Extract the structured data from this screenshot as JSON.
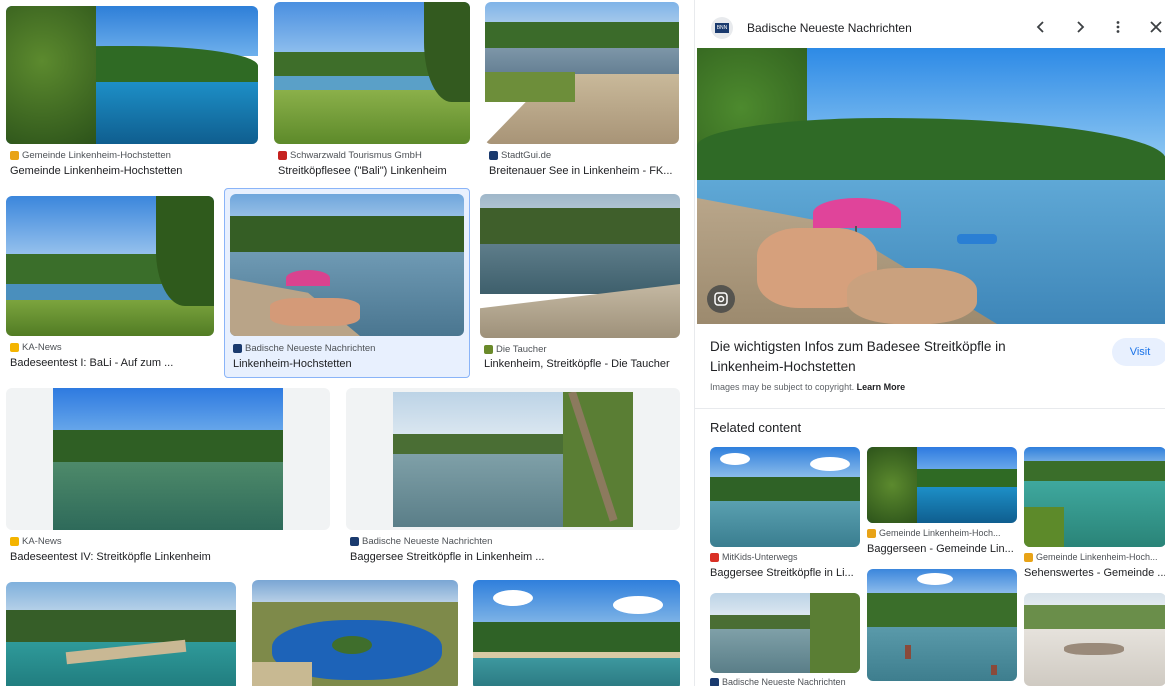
{
  "grid": [
    {
      "source": "Gemeinde Linkenheim-Hochstetten",
      "title": "Gemeinde Linkenheim-Hochstetten",
      "favicon": "crest-icon",
      "favicon_color": "#e8a317"
    },
    {
      "source": "Schwarzwald Tourismus GmbH",
      "title": "Streitköpflesee (\"Bali\") Linkenheim",
      "favicon": "flag-icon",
      "favicon_color": "#c5221f"
    },
    {
      "source": "StadtGui.de",
      "title": "Breitenauer See in Linkenheim - FK...",
      "favicon": "s-icon",
      "favicon_color": "#1a3a6e"
    },
    {
      "source": "KA-News",
      "title": "Badeseentest I: BaLi - Auf zum ...",
      "favicon": "ka-icon",
      "favicon_color": "#f4b400"
    },
    {
      "source": "Badische Neueste Nachrichten",
      "title": "Linkenheim-Hochstetten",
      "favicon": "bnn-icon",
      "favicon_color": "#1a3a6e"
    },
    {
      "source": "Die Taucher",
      "title": "Linkenheim, Streitköpfle - Die Taucher",
      "favicon": "diver-icon",
      "favicon_color": "#6a8a2a"
    },
    {
      "source": "KA-News",
      "title": "Badeseentest IV: Streitköpfle Linkenheim",
      "favicon": "ka-icon",
      "favicon_color": "#f4b400"
    },
    {
      "source": "Badische Neueste Nachrichten",
      "title": "Baggersee Streitköpfle in Linkenheim ...",
      "favicon": "bnn-icon",
      "favicon_color": "#1a3a6e"
    }
  ],
  "panel": {
    "source": "Badische Neueste Nachrichten",
    "logo_text": "BNN",
    "title": "Die wichtigsten Infos zum Badesee Streitköpfle in Linkenheim-Hochstetten",
    "visit_label": "Visit",
    "copyright": "Images may be subject to copyright.",
    "learn_more": "Learn More",
    "related_heading": "Related content",
    "related": [
      {
        "source": "MitKids-Unterwegs",
        "title": "Baggersee Streitköpfle in Li...",
        "favicon_color": "#d93025"
      },
      {
        "source": "Gemeinde Linkenheim-Hoch...",
        "title": "Baggerseen - Gemeinde Lin...",
        "favicon_color": "#e8a317"
      },
      {
        "source": "Gemeinde Linkenheim-Hoch...",
        "title": "Sehenswertes - Gemeinde ...",
        "favicon_color": "#e8a317"
      },
      {
        "source": "Badische Neueste Nachrichten",
        "title": "",
        "favicon_color": "#1a3a6e"
      }
    ]
  },
  "colors": {
    "accent": "#1a73e8",
    "selected_bg": "#e8f0fe",
    "selected_border": "#8ab4f8"
  }
}
